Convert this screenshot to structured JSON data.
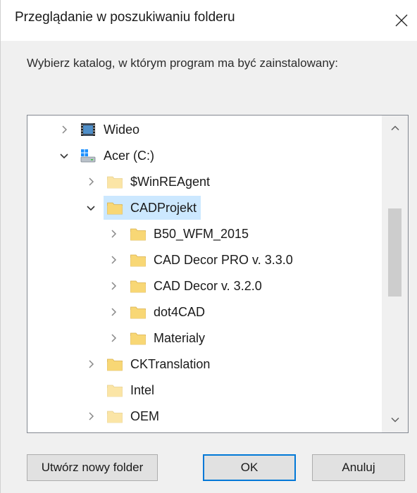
{
  "dialog": {
    "title": "Przeglądanie w poszukiwaniu folderu",
    "instruction": "Wybierz katalog, w którym program ma być zainstalowany:"
  },
  "tree": {
    "rows": [
      {
        "label": "Wideo",
        "indent": 0,
        "expander": "collapsed",
        "icon": "video-icon",
        "selected": false
      },
      {
        "label": "Acer (C:)",
        "indent": 0,
        "expander": "expanded",
        "icon": "drive-icon",
        "selected": false
      },
      {
        "label": "$WinREAgent",
        "indent": 1,
        "expander": "collapsed",
        "icon": "folder-light-icon",
        "selected": false
      },
      {
        "label": "CADProjekt",
        "indent": 1,
        "expander": "expanded",
        "icon": "folder-icon",
        "selected": true
      },
      {
        "label": "B50_WFM_2015",
        "indent": 2,
        "expander": "collapsed",
        "icon": "folder-icon",
        "selected": false
      },
      {
        "label": "CAD Decor PRO v. 3.3.0",
        "indent": 2,
        "expander": "collapsed",
        "icon": "folder-icon",
        "selected": false
      },
      {
        "label": "CAD Decor v. 3.2.0",
        "indent": 2,
        "expander": "collapsed",
        "icon": "folder-icon",
        "selected": false
      },
      {
        "label": "dot4CAD",
        "indent": 2,
        "expander": "collapsed",
        "icon": "folder-icon",
        "selected": false
      },
      {
        "label": "Materialy",
        "indent": 2,
        "expander": "collapsed",
        "icon": "folder-icon",
        "selected": false
      },
      {
        "label": "CKTranslation",
        "indent": 1,
        "expander": "collapsed",
        "icon": "folder-icon",
        "selected": false
      },
      {
        "label": "Intel",
        "indent": 1,
        "expander": "none",
        "icon": "folder-light-icon",
        "selected": false
      },
      {
        "label": "OEM",
        "indent": 1,
        "expander": "collapsed",
        "icon": "folder-light-icon",
        "selected": false
      }
    ],
    "scroll_position": 0.38,
    "scroll_visible_fraction": 0.33
  },
  "buttons": {
    "new_folder": "Utwórz nowy folder",
    "ok": "OK",
    "cancel": "Anuluj"
  },
  "colors": {
    "selection": "#cce8ff",
    "folder": "#f8d775",
    "folder_light": "#fbe5a6",
    "default_button_border": "#0078d7"
  }
}
